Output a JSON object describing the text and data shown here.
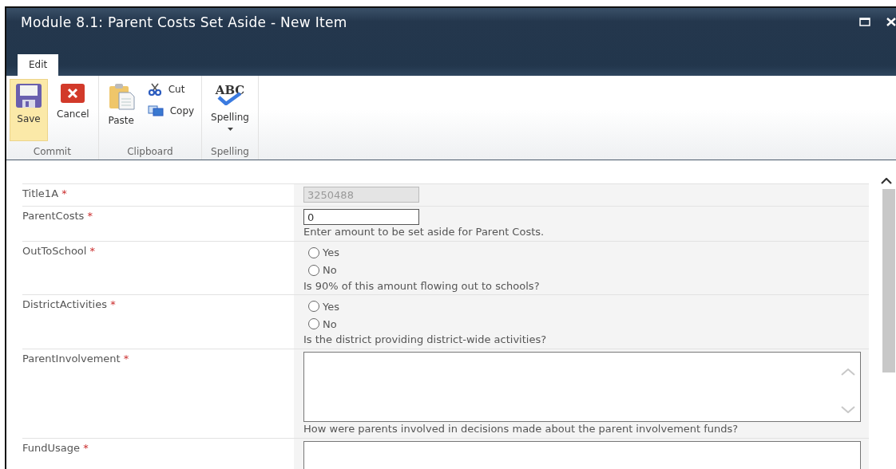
{
  "window": {
    "title": "Module 8.1: Parent Costs Set Aside - New Item"
  },
  "tabs": [
    {
      "label": "Edit",
      "selected": true
    }
  ],
  "ribbon": {
    "groups": [
      {
        "label": "Commit",
        "buttons": [
          {
            "kind": "save",
            "label": "Save",
            "hovered": true
          },
          {
            "kind": "cancel",
            "label": "Cancel",
            "hovered": false
          }
        ]
      },
      {
        "label": "Clipboard",
        "buttons": [
          {
            "kind": "paste",
            "label": "Paste",
            "hovered": false
          },
          {
            "kind": "cut",
            "label": "Cut",
            "hovered": false
          },
          {
            "kind": "copy",
            "label": "Copy",
            "hovered": false
          }
        ]
      },
      {
        "label": "Spelling",
        "buttons": [
          {
            "kind": "spelling",
            "label": "Spelling",
            "icon_text": "ABC",
            "hovered": false
          }
        ]
      }
    ]
  },
  "fields": [
    {
      "label": "Title1A",
      "required_mark": "*",
      "kind": "text",
      "value": "3250488",
      "disabled": true
    },
    {
      "label": "ParentCosts",
      "required_mark": "*",
      "kind": "text",
      "value": "0",
      "disabled": false,
      "description": "Enter amount to be set aside for Parent Costs."
    },
    {
      "label": "OutToSchool",
      "required_mark": "*",
      "kind": "radio",
      "options": [
        {
          "label": "Yes",
          "selected": false
        },
        {
          "label": "No",
          "selected": false
        }
      ],
      "description": "Is 90% of this amount flowing out to schools?"
    },
    {
      "label": "DistrictActivities",
      "required_mark": "*",
      "kind": "radio",
      "options": [
        {
          "label": "Yes",
          "selected": false
        },
        {
          "label": "No",
          "selected": false
        }
      ],
      "description": "Is the district providing district-wide activities?"
    },
    {
      "label": "ParentInvolvement",
      "required_mark": "*",
      "kind": "textarea",
      "description": "How were parents involved in decisions made about the parent involvement funds?"
    },
    {
      "label": "FundUsage",
      "required_mark": "*",
      "kind": "textarea_cut"
    }
  ]
}
